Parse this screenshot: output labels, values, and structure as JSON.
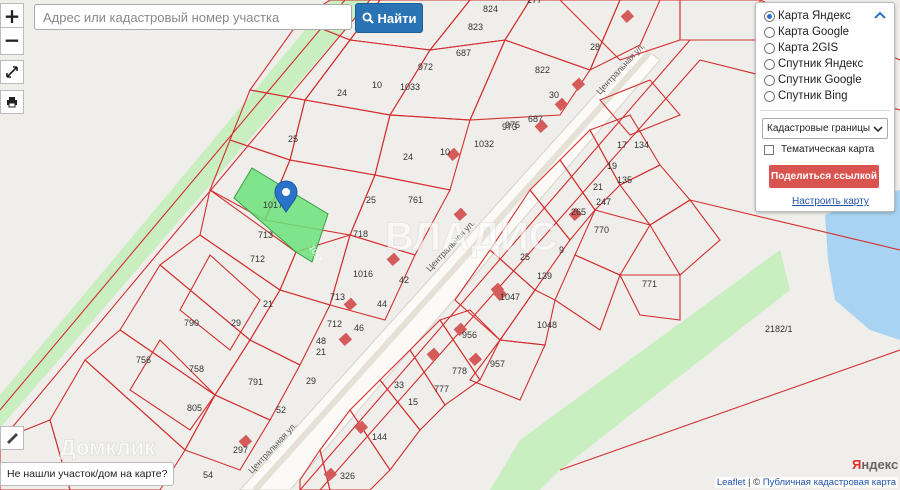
{
  "search": {
    "placeholder": "Адрес или кадастровый номер участка",
    "button_label": "Найти"
  },
  "zoom": {
    "in": "+",
    "out": "−"
  },
  "layers": {
    "options": [
      "Карта Яндекс",
      "Карта Google",
      "Карта 2GIS",
      "Спутник Яндекс",
      "Спутник Google",
      "Спутник Bing"
    ],
    "selected": "Карта Яндекс",
    "boundary_select": "Кадастровые границы",
    "thematic_label": "Тематическая карта",
    "share_button": "Поделиться ссылкой",
    "setup_link": "Настроить карту"
  },
  "not_found_label": "Не нашли участок/дом на карте?",
  "attribution": {
    "leaflet": "Leaflet",
    "sep": " | © ",
    "source": "Публичная кадастровая карта"
  },
  "logo": {
    "y": "Я",
    "rest": "ндекс"
  },
  "watermarks": {
    "brand": "ВЛАДИС",
    "domclick": "Домклик"
  },
  "streets": [
    "Центральная ул.",
    "Центральная ул.",
    "Центральная ул."
  ],
  "selected_parcel": "1017",
  "parcel_labels": [
    "824",
    "277",
    "823",
    "687",
    "822",
    "28",
    "972",
    "1033",
    "10",
    "30",
    "24",
    "973",
    "687",
    "1032",
    "10",
    "24",
    "25",
    "25",
    "761",
    "718",
    "713",
    "712",
    "1016",
    "1017",
    "713",
    "42",
    "44",
    "21",
    "712",
    "29",
    "46",
    "48",
    "21",
    "790",
    "756",
    "758",
    "791",
    "805",
    "29",
    "52",
    "297",
    "54",
    "326",
    "144",
    "15",
    "33",
    "777",
    "778",
    "956",
    "957",
    "1047",
    "1048",
    "139",
    "9",
    "25",
    "770",
    "771",
    "247",
    "135",
    "19",
    "17",
    "134",
    "21",
    "265",
    "2182/1",
    "975"
  ],
  "colors": {
    "parcel_stroke": "#d32f2f",
    "selected_fill": "#6be27a",
    "greenery": "#c9eec0",
    "road": "#f4f2ee",
    "building": "#d55b5b"
  }
}
